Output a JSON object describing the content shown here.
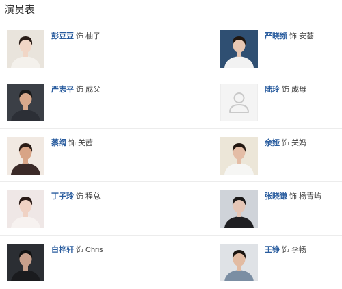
{
  "header": {
    "title": "演员表"
  },
  "cast": [
    {
      "actor": "彭豆豆",
      "sep": "饰",
      "role": "柚子",
      "photo": {
        "bg": "#e9e4dc",
        "skin": "#f1d6c6",
        "hair": "#2b1e18",
        "clothes": "#f4f1ec"
      }
    },
    {
      "actor": "严晓频",
      "sep": "饰",
      "role": "安荟",
      "photo": {
        "bg": "#2f4f72",
        "skin": "#e7c7b3",
        "hair": "#20160f",
        "clothes": "#f2f2f2"
      }
    },
    {
      "actor": "严志平",
      "sep": "饰",
      "role": "成父",
      "photo": {
        "bg": "#3b3f46",
        "skin": "#d9a98c",
        "hair": "#1a1a1a",
        "clothes": "#2c2f36"
      }
    },
    {
      "actor": "陆玲",
      "sep": "饰",
      "role": "成母",
      "photo": {
        "placeholder": true
      }
    },
    {
      "actor": "蔡纲",
      "sep": "饰",
      "role": "关茜",
      "photo": {
        "bg": "#f1e9e2",
        "skin": "#d8a486",
        "hair": "#2a1c16",
        "clothes": "#3b2a28"
      }
    },
    {
      "actor": "余娅",
      "sep": "饰",
      "role": "关妈",
      "photo": {
        "bg": "#ece6d8",
        "skin": "#e4bda6",
        "hair": "#231812",
        "clothes": "#f6f6f4"
      }
    },
    {
      "actor": "丁子玲",
      "sep": "饰",
      "role": "程总",
      "photo": {
        "bg": "#efe7e6",
        "skin": "#f0d2c4",
        "hair": "#2b1b17",
        "clothes": "#f7f2f0"
      }
    },
    {
      "actor": "张晓谦",
      "sep": "饰",
      "role": "杨青屿",
      "photo": {
        "bg": "#cfd3d9",
        "skin": "#e5c6b6",
        "hair": "#1c1a1a",
        "clothes": "#1f1f22"
      }
    },
    {
      "actor": "白梓轩",
      "sep": "饰",
      "role": "Chris",
      "photo": {
        "bg": "#2b2e33",
        "skin": "#c8a08c",
        "hair": "#121212",
        "clothes": "#1a1b1e"
      }
    },
    {
      "actor": "王铮",
      "sep": "饰",
      "role": "李畅",
      "photo": {
        "bg": "#dfe2e6",
        "skin": "#e2bba2",
        "hair": "#1a1410",
        "clothes": "#7b8ea3"
      }
    }
  ]
}
